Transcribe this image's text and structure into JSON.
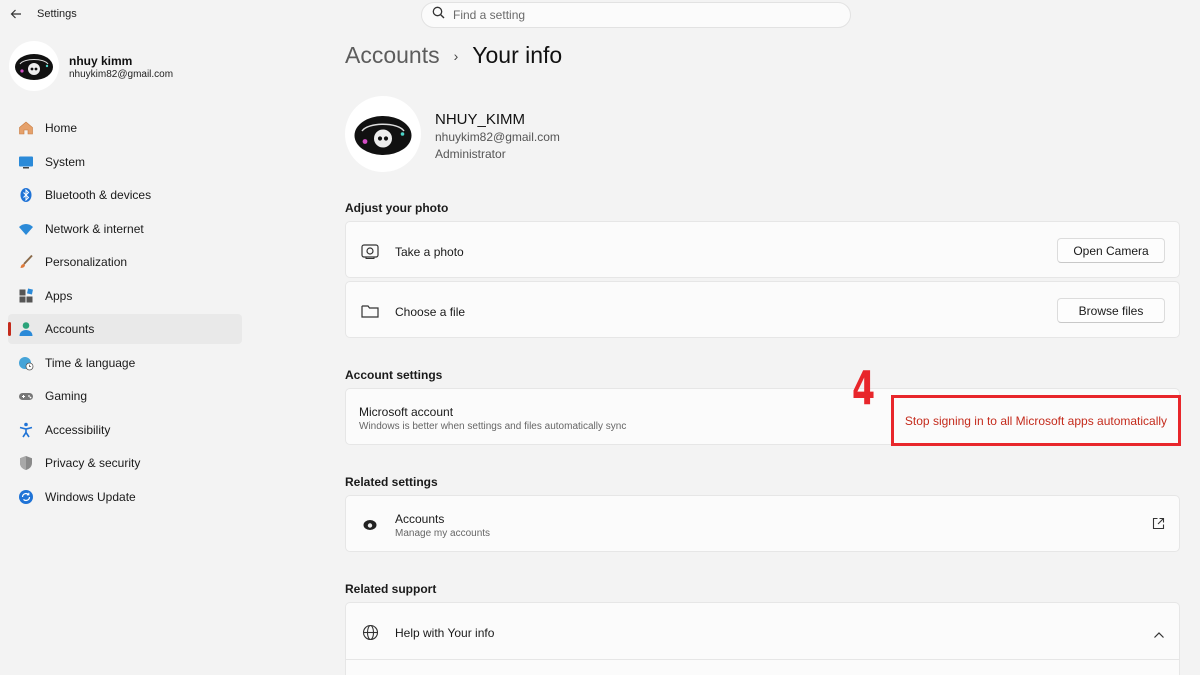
{
  "titlebar": {
    "app_title": "Settings",
    "search_placeholder": "Find a setting"
  },
  "profile": {
    "name": "nhuy kimm",
    "email": "nhuykim82@gmail.com"
  },
  "nav": {
    "items": [
      {
        "label": "Home",
        "icon": "home-icon",
        "active": false
      },
      {
        "label": "System",
        "icon": "system-icon",
        "active": false
      },
      {
        "label": "Bluetooth & devices",
        "icon": "bluetooth-icon",
        "active": false
      },
      {
        "label": "Network & internet",
        "icon": "wifi-icon",
        "active": false
      },
      {
        "label": "Personalization",
        "icon": "brush-icon",
        "active": false
      },
      {
        "label": "Apps",
        "icon": "apps-icon",
        "active": false
      },
      {
        "label": "Accounts",
        "icon": "person-icon",
        "active": true
      },
      {
        "label": "Time & language",
        "icon": "globe-clock-icon",
        "active": false
      },
      {
        "label": "Gaming",
        "icon": "gamepad-icon",
        "active": false
      },
      {
        "label": "Accessibility",
        "icon": "accessibility-icon",
        "active": false
      },
      {
        "label": "Privacy & security",
        "icon": "shield-icon",
        "active": false
      },
      {
        "label": "Windows Update",
        "icon": "update-icon",
        "active": false
      }
    ]
  },
  "main": {
    "breadcrumb": {
      "parent": "Accounts",
      "separator": "›",
      "current": "Your info"
    },
    "user": {
      "name": "NHUY_KIMM",
      "email": "nhuykim82@gmail.com",
      "role": "Administrator"
    },
    "adjust_photo": {
      "title": "Adjust your photo",
      "take_photo": {
        "label": "Take a photo",
        "button": "Open Camera"
      },
      "choose_file": {
        "label": "Choose a file",
        "button": "Browse files"
      }
    },
    "account_settings": {
      "title": "Account settings",
      "microsoft_account": {
        "title": "Microsoft account",
        "subtitle": "Windows is better when settings and files automatically sync",
        "link": "Stop signing in to all Microsoft apps automatically"
      }
    },
    "related_settings": {
      "title": "Related settings",
      "accounts": {
        "title": "Accounts",
        "subtitle": "Manage my accounts"
      }
    },
    "related_support": {
      "title": "Related support",
      "help": {
        "label": "Help with Your info"
      }
    }
  },
  "annotation": {
    "step_number": "4",
    "color": "#e8262b"
  },
  "colors": {
    "accent": "#c42b1c",
    "background": "#f3f3f3",
    "card": "#fbfbfb"
  }
}
